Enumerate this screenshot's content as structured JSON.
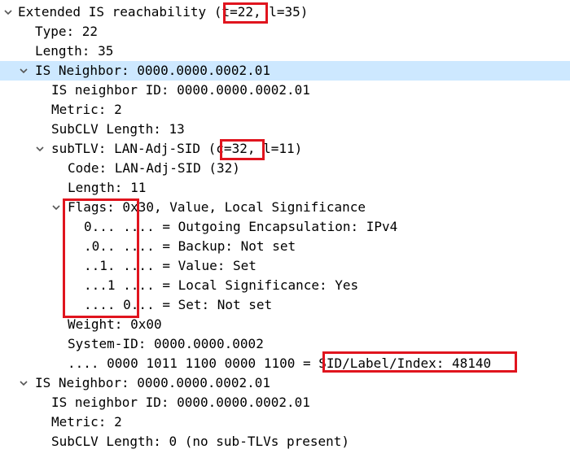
{
  "tree": {
    "extended_is": {
      "prefix": "Extended IS reachability (",
      "t": "t=22",
      "suffix": ", l=35)"
    },
    "type": "Type: 22",
    "length": "Length: 35",
    "neighbor1": {
      "header": "IS Neighbor: 0000.0000.0002.01",
      "id": "IS neighbor ID: 0000.0000.0002.01",
      "metric": "Metric: 2",
      "subclv_length": "SubCLV Length: 13",
      "subtlv": {
        "prefix": "subTLV: LAN-Adj-SID (",
        "c": "c=32",
        "suffix": ", l=11)",
        "code": "Code: LAN-Adj-SID (32)",
        "length": "Length: 11",
        "flags": {
          "header": "Flags: 0x30, Value, Local Significance",
          "bits": [
            "0... .... = Outgoing Encapsulation: IPv4",
            ".0.. .... = Backup: Not set",
            "..1. .... = Value: Set",
            "...1 .... = Local Significance: Yes",
            ".... 0... = Set: Not set"
          ]
        },
        "weight": "Weight: 0x00",
        "system_id": "System-ID: 0000.0000.0002",
        "sid_bits": ".... 0000 1011 1100 0000 1100 = ",
        "sid_label": "SID/Label/Index: 48140"
      }
    },
    "neighbor2": {
      "header": "IS Neighbor: 0000.0000.0002.01",
      "id": "IS neighbor ID: 0000.0000.0002.01",
      "metric": "Metric: 2",
      "subclv_length": "SubCLV Length: 0 (no sub-TLVs present)"
    }
  },
  "colors": {
    "selection": "#cde8ff",
    "highlight_box": "#e0141e",
    "toggle": "#555555"
  },
  "icons": [
    "chevron-down-icon"
  ]
}
